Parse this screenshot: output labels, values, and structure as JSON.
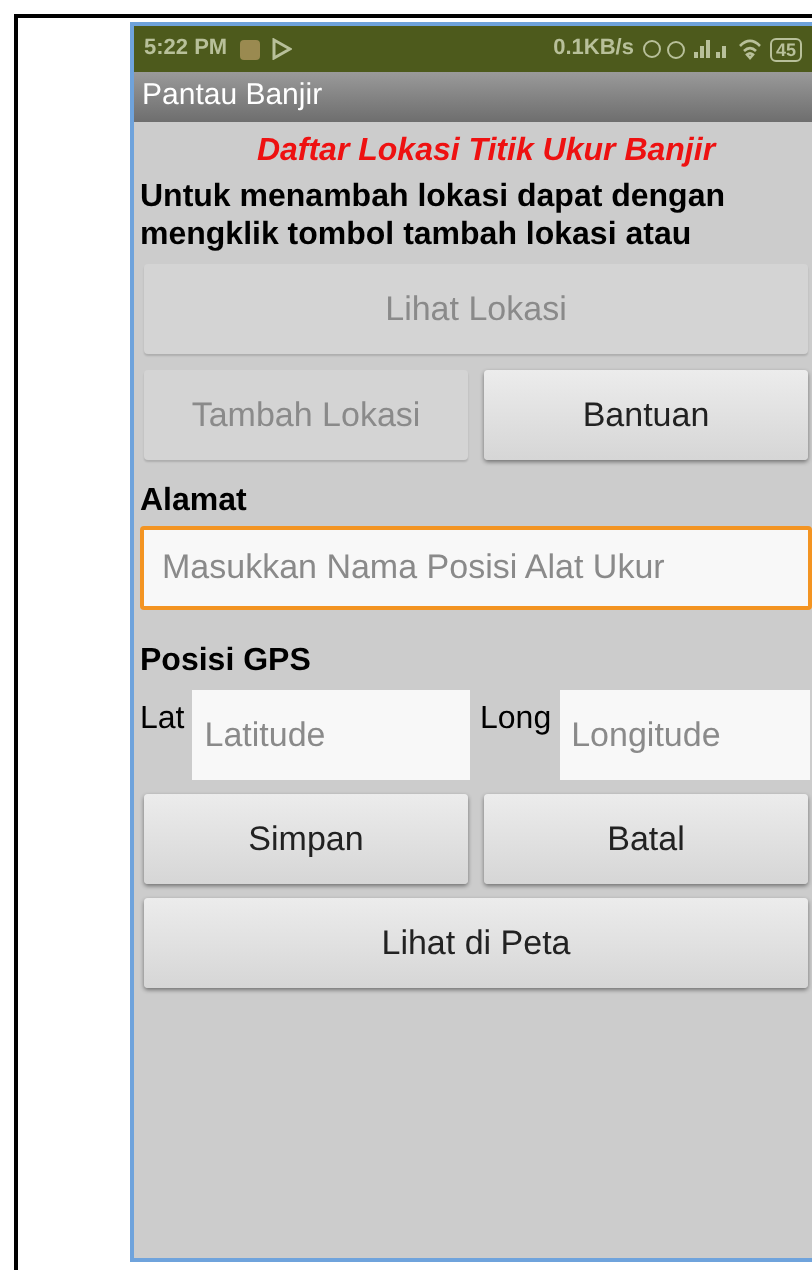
{
  "status_bar": {
    "time": "5:22 PM",
    "speed": "0.1KB/s",
    "battery": "45"
  },
  "app_bar": {
    "title": "Pantau Banjir"
  },
  "heading": "Daftar Lokasi Titik Ukur Banjir",
  "description": "Untuk menambah lokasi dapat dengan mengklik tombol tambah lokasi atau",
  "top_buttons": [
    {
      "label": "Lihat Lokasi",
      "disabled": true
    }
  ],
  "action_buttons": [
    {
      "label": "Tambah Lokasi",
      "disabled": true
    },
    {
      "label": "Bantuan",
      "disabled": false
    }
  ],
  "address": {
    "label": "Alamat",
    "placeholder": "Masukkan Nama Posisi Alat Ukur",
    "focused": true
  },
  "gps": {
    "label": "Posisi GPS",
    "fields": [
      {
        "label": "Lat",
        "placeholder": "Latitude"
      },
      {
        "label": "Long",
        "placeholder": "Longitude"
      }
    ]
  },
  "form_buttons": [
    {
      "label": "Simpan",
      "disabled": false
    },
    {
      "label": "Batal",
      "disabled": false
    }
  ],
  "map_button": {
    "label": "Lihat di Peta",
    "disabled": false
  }
}
